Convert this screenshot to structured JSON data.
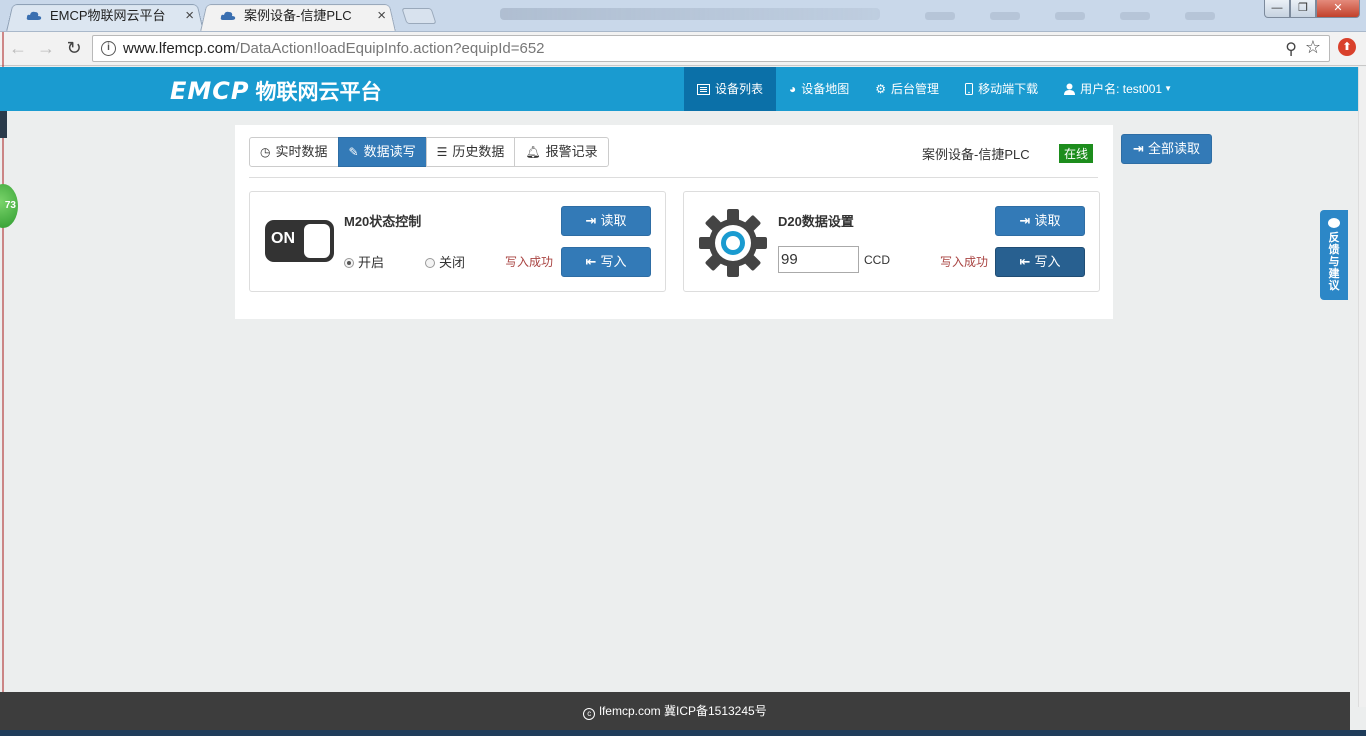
{
  "browser": {
    "tabs": [
      {
        "title": "EMCP物联网云平台",
        "active": false
      },
      {
        "title": "案例设备-信捷PLC",
        "active": true
      }
    ],
    "tab_close_glyph": "×",
    "url_host": "www.lfemcp.com",
    "url_path": "/DataAction!loadEquipInfo.action?equipId=652",
    "window_buttons": [
      "—",
      "❐",
      "✕"
    ]
  },
  "header": {
    "logo_latin": "EMCP",
    "logo_cn": "物联网云平台",
    "nav": [
      {
        "label": "设备列表",
        "icon": "list-icon",
        "active": true
      },
      {
        "label": "设备地图",
        "icon": "globe-icon",
        "active": false
      },
      {
        "label": "后台管理",
        "icon": "gears-icon",
        "active": false
      },
      {
        "label": "移动端下载",
        "icon": "mobile-icon",
        "active": false
      },
      {
        "label": "用户名: test001",
        "icon": "user-icon",
        "active": false
      }
    ]
  },
  "tabs": [
    {
      "label": "实时数据",
      "icon": "clock-icon",
      "active": false
    },
    {
      "label": "数据读写",
      "icon": "pencil-icon",
      "active": true
    },
    {
      "label": "历史数据",
      "icon": "list-icon",
      "active": false
    },
    {
      "label": "报警记录",
      "icon": "bell-icon",
      "active": false
    }
  ],
  "device": {
    "name": "案例设备-信捷PLC",
    "status": "在线",
    "status_color": "#1d8d1d"
  },
  "read_all_label": "全部读取",
  "cards": [
    {
      "title": "M20状态控制",
      "switch_text": "ON",
      "read_label": "读取",
      "write_label": "写入",
      "status_text": "写入成功",
      "radio_on": "开启",
      "radio_off": "关闭",
      "selected": "开启"
    },
    {
      "title": "D20数据设置",
      "read_label": "读取",
      "write_label": "写入",
      "status_text": "写入成功",
      "value": "99",
      "unit": "CCD"
    }
  ],
  "feedback_label": "反馈与建议",
  "float_ball_value": "73",
  "footer": {
    "text": "lfemcp.com 冀ICP备1513245号"
  },
  "colors": {
    "header_bg": "#1a9bd0",
    "nav_active": "#0b70a8",
    "primary": "#337ab7",
    "success_text": "#a94442",
    "footer_bg": "#3d3d3d"
  }
}
